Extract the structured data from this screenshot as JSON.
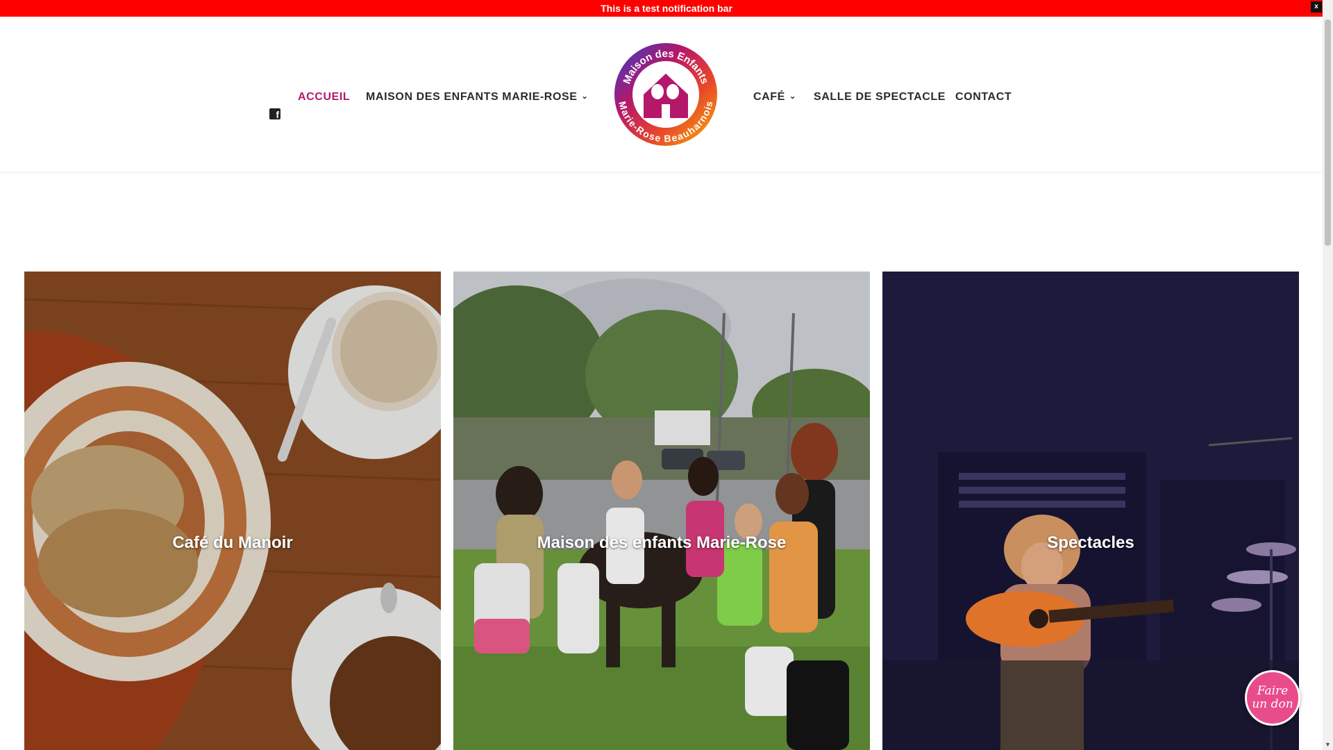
{
  "notification": {
    "text": "This is a test notification bar",
    "close_label": "x"
  },
  "nav": {
    "facebook_icon": "facebook-icon",
    "left": [
      {
        "label": "ACCUEIL",
        "active": true
      },
      {
        "label": "MAISON DES ENFANTS MARIE-ROSE",
        "dropdown": true
      }
    ],
    "right": [
      {
        "label": "CAFÉ",
        "dropdown": true
      },
      {
        "label": "SALLE DE SPECTACLE"
      },
      {
        "label": "CONTACT"
      }
    ],
    "chevron": "⌄"
  },
  "logo": {
    "top_text": "Maison des Enfants",
    "bottom_text": "Marie-Rose Beauharnois"
  },
  "tiles": [
    {
      "label": "Café du Manoir"
    },
    {
      "label": "Maison des enfants Marie-Rose"
    },
    {
      "label": "Spectacles"
    }
  ],
  "donate": {
    "line1": "Faire",
    "line2": "un don"
  },
  "colors": {
    "notification": "#ff0000",
    "accent": "#b5176a",
    "donate": "#e94c8a"
  }
}
